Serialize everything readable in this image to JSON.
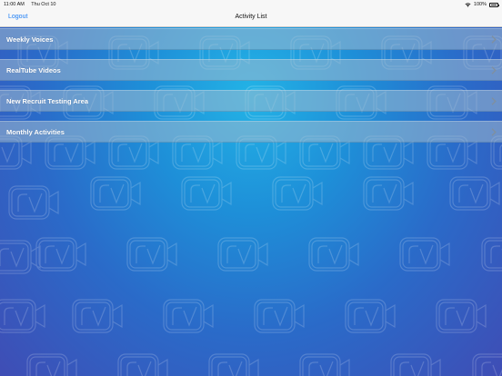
{
  "status_bar": {
    "time": "11:00 AM",
    "date": "Thu Oct 10",
    "battery_percent": "100%"
  },
  "nav": {
    "logout_label": "Logout",
    "title": "Activity List"
  },
  "activities": [
    {
      "label": "Weekly Voices"
    },
    {
      "label": "RealTube Videos"
    },
    {
      "label": "New Recruit Testing Area"
    },
    {
      "label": "Monthly Activities"
    }
  ],
  "icons": {
    "row_disclosure": "chevron-right-icon",
    "background_logo": "rv-logo-pattern"
  },
  "colors": {
    "accent": "#1a7cf5",
    "background_top": "#23b3e6",
    "background_bottom": "#3f4db5"
  }
}
